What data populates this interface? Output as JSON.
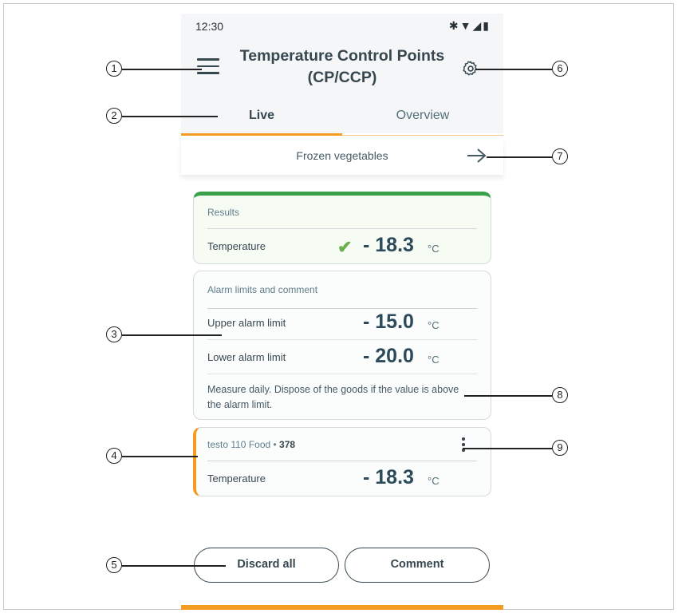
{
  "status_bar": {
    "time": "12:30",
    "icons": [
      "bluetooth-icon",
      "wifi-icon",
      "signal-icon",
      "battery-icon"
    ]
  },
  "header": {
    "title": "Temperature Control Points (CP/CCP)"
  },
  "tabs": [
    {
      "label": "Live",
      "active": true
    },
    {
      "label": "Overview",
      "active": false
    }
  ],
  "subheader": {
    "label": "Frozen vegetables"
  },
  "results": {
    "header": "Results",
    "rows": [
      {
        "label": "Temperature",
        "value": "- 18.3",
        "unit": "°C",
        "status": "ok"
      }
    ]
  },
  "alarm": {
    "header": "Alarm limits and comment",
    "rows": [
      {
        "label": "Upper alarm limit",
        "value": "- 15.0",
        "unit": "°C"
      },
      {
        "label": "Lower alarm limit",
        "value": "- 20.0",
        "unit": "°C"
      }
    ],
    "comment": "Measure daily. Dispose of the goods if the value is above the alarm limit."
  },
  "device": {
    "name": "testo 110 Food",
    "separator": " • ",
    "serial": "378",
    "rows": [
      {
        "label": "Temperature",
        "value": "- 18.3",
        "unit": "°C"
      }
    ]
  },
  "buttons": {
    "discard": "Discard all",
    "comment": "Comment"
  },
  "callouts": [
    "1",
    "2",
    "3",
    "4",
    "5",
    "6",
    "7",
    "8",
    "9"
  ],
  "colors": {
    "accent": "#f39c21",
    "ok": "#3aa04a",
    "text": "#37474f"
  }
}
